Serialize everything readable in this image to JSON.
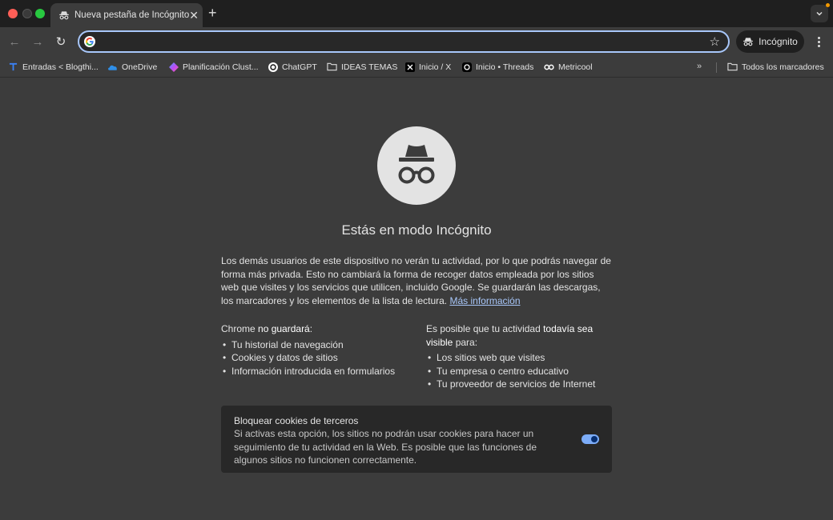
{
  "tab": {
    "title": "Nueva pestaña de Incógnito",
    "close": "✕",
    "new_tab": "+"
  },
  "toolbar": {
    "back": "←",
    "forward": "→",
    "reload": "↻",
    "omnibox_value": "",
    "star": "☆",
    "incognito_label": "Incógnito"
  },
  "bookmarks": {
    "items": [
      {
        "label": "Entradas < Blogthi...",
        "icon": "blogger-t-icon"
      },
      {
        "label": "OneDrive",
        "icon": "onedrive-cloud-icon"
      },
      {
        "label": "Planificación Clust...",
        "icon": "diamond-gradient-icon"
      },
      {
        "label": "ChatGPT",
        "icon": "chatgpt-icon"
      },
      {
        "label": "IDEAS TEMAS",
        "icon": "folder-icon"
      },
      {
        "label": "Inicio / X",
        "icon": "x-logo-icon"
      },
      {
        "label": "Inicio • Threads",
        "icon": "threads-icon"
      },
      {
        "label": "Metricool",
        "icon": "metricool-icon"
      }
    ],
    "overflow": "»",
    "all_bookmarks": "Todos los marcadores"
  },
  "content": {
    "heading": "Estás en modo Incógnito",
    "intro": "Los demás usuarios de este dispositivo no verán tu actividad, por lo que podrás navegar de forma más privada. Esto no cambiará la forma de recoger datos empleada por los sitios web que visites y los servicios que utilicen, incluido Google. Se guardarán las descargas, los marcadores y los elementos de la lista de lectura.",
    "more_info": "Más información",
    "left": {
      "title_a": "Chrome ",
      "title_b": "no guardará",
      "title_c": ":",
      "items": [
        "Tu historial de navegación",
        "Cookies y datos de sitios",
        "Información introducida en formularios"
      ]
    },
    "right": {
      "title_a": "Es posible que tu actividad ",
      "title_b": "todavía sea visible",
      "title_c": " para:",
      "items": [
        "Los sitios web que visites",
        "Tu empresa o centro educativo",
        "Tu proveedor de servicios de Internet"
      ]
    },
    "cookies": {
      "title": "Bloquear cookies de terceros",
      "description": "Si activas esta opción, los sitios no podrán usar cookies para hacer un seguimiento de tu actividad en la Web. Es posible que las funciones de algunos sitios no funcionen correctamente.",
      "toggle_on": true
    }
  },
  "colors": {
    "accent": "#a8c7fa",
    "background": "#3c3c3c",
    "card": "#282828"
  }
}
